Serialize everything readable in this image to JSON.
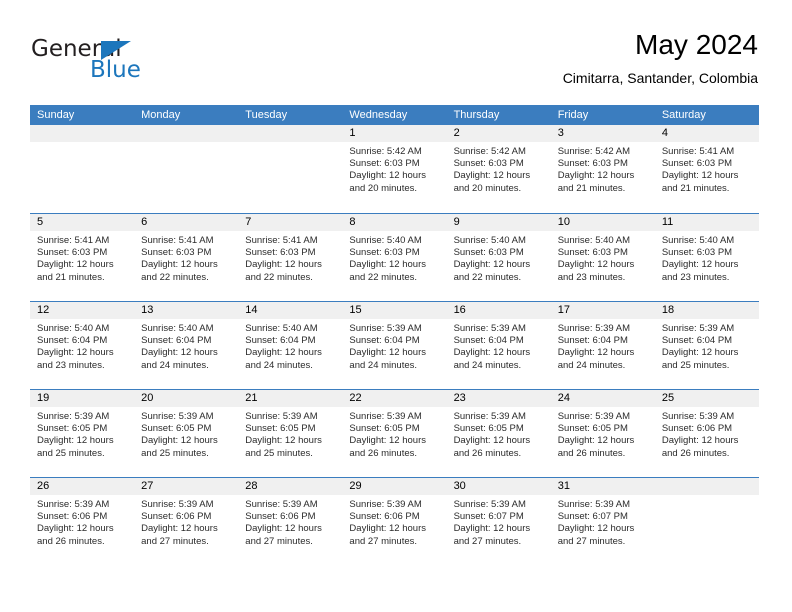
{
  "brand": {
    "name_part1": "General",
    "name_part2": "Blue",
    "accent_color": "#1c76bc"
  },
  "header": {
    "title": "May 2024",
    "subtitle": "Cimitarra, Santander, Colombia"
  },
  "theme": {
    "header_row_bg": "#3b7dbf",
    "day_band_bg": "#f0f0f0",
    "text_color": "#2b2b2b"
  },
  "weekdays": [
    "Sunday",
    "Monday",
    "Tuesday",
    "Wednesday",
    "Thursday",
    "Friday",
    "Saturday"
  ],
  "weeks": [
    [
      {
        "day": "",
        "empty": true,
        "sunrise": "",
        "sunset": "",
        "daylight1": "",
        "daylight2": ""
      },
      {
        "day": "",
        "empty": true,
        "sunrise": "",
        "sunset": "",
        "daylight1": "",
        "daylight2": ""
      },
      {
        "day": "",
        "empty": true,
        "sunrise": "",
        "sunset": "",
        "daylight1": "",
        "daylight2": ""
      },
      {
        "day": "1",
        "sunrise": "Sunrise: 5:42 AM",
        "sunset": "Sunset: 6:03 PM",
        "daylight1": "Daylight: 12 hours",
        "daylight2": "and 20 minutes."
      },
      {
        "day": "2",
        "sunrise": "Sunrise: 5:42 AM",
        "sunset": "Sunset: 6:03 PM",
        "daylight1": "Daylight: 12 hours",
        "daylight2": "and 20 minutes."
      },
      {
        "day": "3",
        "sunrise": "Sunrise: 5:42 AM",
        "sunset": "Sunset: 6:03 PM",
        "daylight1": "Daylight: 12 hours",
        "daylight2": "and 21 minutes."
      },
      {
        "day": "4",
        "sunrise": "Sunrise: 5:41 AM",
        "sunset": "Sunset: 6:03 PM",
        "daylight1": "Daylight: 12 hours",
        "daylight2": "and 21 minutes."
      }
    ],
    [
      {
        "day": "5",
        "sunrise": "Sunrise: 5:41 AM",
        "sunset": "Sunset: 6:03 PM",
        "daylight1": "Daylight: 12 hours",
        "daylight2": "and 21 minutes."
      },
      {
        "day": "6",
        "sunrise": "Sunrise: 5:41 AM",
        "sunset": "Sunset: 6:03 PM",
        "daylight1": "Daylight: 12 hours",
        "daylight2": "and 22 minutes."
      },
      {
        "day": "7",
        "sunrise": "Sunrise: 5:41 AM",
        "sunset": "Sunset: 6:03 PM",
        "daylight1": "Daylight: 12 hours",
        "daylight2": "and 22 minutes."
      },
      {
        "day": "8",
        "sunrise": "Sunrise: 5:40 AM",
        "sunset": "Sunset: 6:03 PM",
        "daylight1": "Daylight: 12 hours",
        "daylight2": "and 22 minutes."
      },
      {
        "day": "9",
        "sunrise": "Sunrise: 5:40 AM",
        "sunset": "Sunset: 6:03 PM",
        "daylight1": "Daylight: 12 hours",
        "daylight2": "and 22 minutes."
      },
      {
        "day": "10",
        "sunrise": "Sunrise: 5:40 AM",
        "sunset": "Sunset: 6:03 PM",
        "daylight1": "Daylight: 12 hours",
        "daylight2": "and 23 minutes."
      },
      {
        "day": "11",
        "sunrise": "Sunrise: 5:40 AM",
        "sunset": "Sunset: 6:03 PM",
        "daylight1": "Daylight: 12 hours",
        "daylight2": "and 23 minutes."
      }
    ],
    [
      {
        "day": "12",
        "sunrise": "Sunrise: 5:40 AM",
        "sunset": "Sunset: 6:04 PM",
        "daylight1": "Daylight: 12 hours",
        "daylight2": "and 23 minutes."
      },
      {
        "day": "13",
        "sunrise": "Sunrise: 5:40 AM",
        "sunset": "Sunset: 6:04 PM",
        "daylight1": "Daylight: 12 hours",
        "daylight2": "and 24 minutes."
      },
      {
        "day": "14",
        "sunrise": "Sunrise: 5:40 AM",
        "sunset": "Sunset: 6:04 PM",
        "daylight1": "Daylight: 12 hours",
        "daylight2": "and 24 minutes."
      },
      {
        "day": "15",
        "sunrise": "Sunrise: 5:39 AM",
        "sunset": "Sunset: 6:04 PM",
        "daylight1": "Daylight: 12 hours",
        "daylight2": "and 24 minutes."
      },
      {
        "day": "16",
        "sunrise": "Sunrise: 5:39 AM",
        "sunset": "Sunset: 6:04 PM",
        "daylight1": "Daylight: 12 hours",
        "daylight2": "and 24 minutes."
      },
      {
        "day": "17",
        "sunrise": "Sunrise: 5:39 AM",
        "sunset": "Sunset: 6:04 PM",
        "daylight1": "Daylight: 12 hours",
        "daylight2": "and 24 minutes."
      },
      {
        "day": "18",
        "sunrise": "Sunrise: 5:39 AM",
        "sunset": "Sunset: 6:04 PM",
        "daylight1": "Daylight: 12 hours",
        "daylight2": "and 25 minutes."
      }
    ],
    [
      {
        "day": "19",
        "sunrise": "Sunrise: 5:39 AM",
        "sunset": "Sunset: 6:05 PM",
        "daylight1": "Daylight: 12 hours",
        "daylight2": "and 25 minutes."
      },
      {
        "day": "20",
        "sunrise": "Sunrise: 5:39 AM",
        "sunset": "Sunset: 6:05 PM",
        "daylight1": "Daylight: 12 hours",
        "daylight2": "and 25 minutes."
      },
      {
        "day": "21",
        "sunrise": "Sunrise: 5:39 AM",
        "sunset": "Sunset: 6:05 PM",
        "daylight1": "Daylight: 12 hours",
        "daylight2": "and 25 minutes."
      },
      {
        "day": "22",
        "sunrise": "Sunrise: 5:39 AM",
        "sunset": "Sunset: 6:05 PM",
        "daylight1": "Daylight: 12 hours",
        "daylight2": "and 26 minutes."
      },
      {
        "day": "23",
        "sunrise": "Sunrise: 5:39 AM",
        "sunset": "Sunset: 6:05 PM",
        "daylight1": "Daylight: 12 hours",
        "daylight2": "and 26 minutes."
      },
      {
        "day": "24",
        "sunrise": "Sunrise: 5:39 AM",
        "sunset": "Sunset: 6:05 PM",
        "daylight1": "Daylight: 12 hours",
        "daylight2": "and 26 minutes."
      },
      {
        "day": "25",
        "sunrise": "Sunrise: 5:39 AM",
        "sunset": "Sunset: 6:06 PM",
        "daylight1": "Daylight: 12 hours",
        "daylight2": "and 26 minutes."
      }
    ],
    [
      {
        "day": "26",
        "sunrise": "Sunrise: 5:39 AM",
        "sunset": "Sunset: 6:06 PM",
        "daylight1": "Daylight: 12 hours",
        "daylight2": "and 26 minutes."
      },
      {
        "day": "27",
        "sunrise": "Sunrise: 5:39 AM",
        "sunset": "Sunset: 6:06 PM",
        "daylight1": "Daylight: 12 hours",
        "daylight2": "and 27 minutes."
      },
      {
        "day": "28",
        "sunrise": "Sunrise: 5:39 AM",
        "sunset": "Sunset: 6:06 PM",
        "daylight1": "Daylight: 12 hours",
        "daylight2": "and 27 minutes."
      },
      {
        "day": "29",
        "sunrise": "Sunrise: 5:39 AM",
        "sunset": "Sunset: 6:06 PM",
        "daylight1": "Daylight: 12 hours",
        "daylight2": "and 27 minutes."
      },
      {
        "day": "30",
        "sunrise": "Sunrise: 5:39 AM",
        "sunset": "Sunset: 6:07 PM",
        "daylight1": "Daylight: 12 hours",
        "daylight2": "and 27 minutes."
      },
      {
        "day": "31",
        "sunrise": "Sunrise: 5:39 AM",
        "sunset": "Sunset: 6:07 PM",
        "daylight1": "Daylight: 12 hours",
        "daylight2": "and 27 minutes."
      },
      {
        "day": "",
        "empty": true,
        "sunrise": "",
        "sunset": "",
        "daylight1": "",
        "daylight2": ""
      }
    ]
  ]
}
